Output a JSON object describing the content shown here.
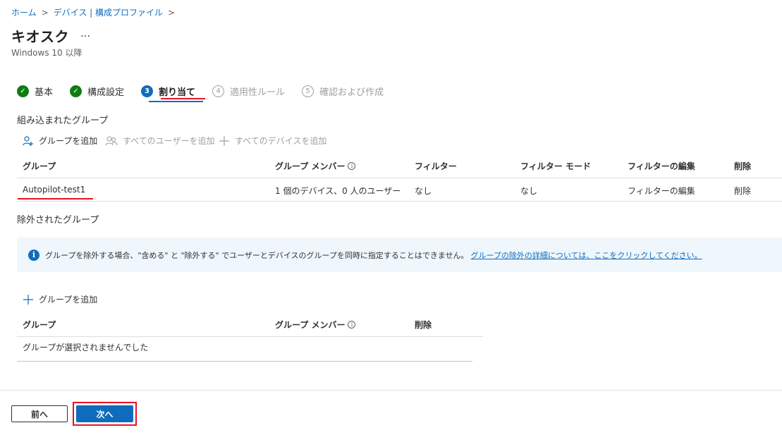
{
  "breadcrumb": {
    "items": [
      "ホーム",
      "デバイス | 構成プロファイル"
    ],
    "separator": ">"
  },
  "page": {
    "title": "キオスク",
    "more": "…",
    "subtitle": "Windows 10 以降"
  },
  "steps": [
    {
      "label": "基本",
      "state": "done",
      "marker": "✓"
    },
    {
      "label": "構成設定",
      "state": "done",
      "marker": "✓"
    },
    {
      "label": "割り当て",
      "state": "current",
      "marker": "3"
    },
    {
      "label": "適用性ルール",
      "state": "todo",
      "marker": "4"
    },
    {
      "label": "確認および作成",
      "state": "todo",
      "marker": "5"
    }
  ],
  "included": {
    "title": "組み込まれたグループ",
    "toolbar": {
      "add_group": "グループを追加",
      "add_all_users": "すべてのユーザーを追加",
      "add_all_devices": "すべてのデバイスを追加"
    },
    "columns": {
      "group": "グループ",
      "members": "グループ メンバー",
      "filter": "フィルター",
      "filter_mode": "フィルター モード",
      "edit_filter": "フィルターの編集",
      "delete": "削除"
    },
    "rows": [
      {
        "group": "Autopilot-test1",
        "members": "1 個のデバイス、0 人のユーザー",
        "filter": "なし",
        "filter_mode": "なし",
        "edit_filter": "フィルターの編集",
        "delete": "削除"
      }
    ]
  },
  "excluded": {
    "title": "除外されたグループ",
    "info": {
      "text": "グループを除外する場合、\"含める\" と \"除外する\" でユーザーとデバイスのグループを同時に指定することはできません。",
      "link": "グループの除外の詳細については、ここをクリックしてください。"
    },
    "add_group": "グループを追加",
    "columns": {
      "group": "グループ",
      "members": "グループ メンバー",
      "delete": "削除"
    },
    "empty": "グループが選択されませんでした"
  },
  "footer": {
    "prev": "前へ",
    "next": "次へ"
  },
  "colors": {
    "accent": "#0f6cbd",
    "done": "#107c10",
    "highlight": "#e81123"
  }
}
